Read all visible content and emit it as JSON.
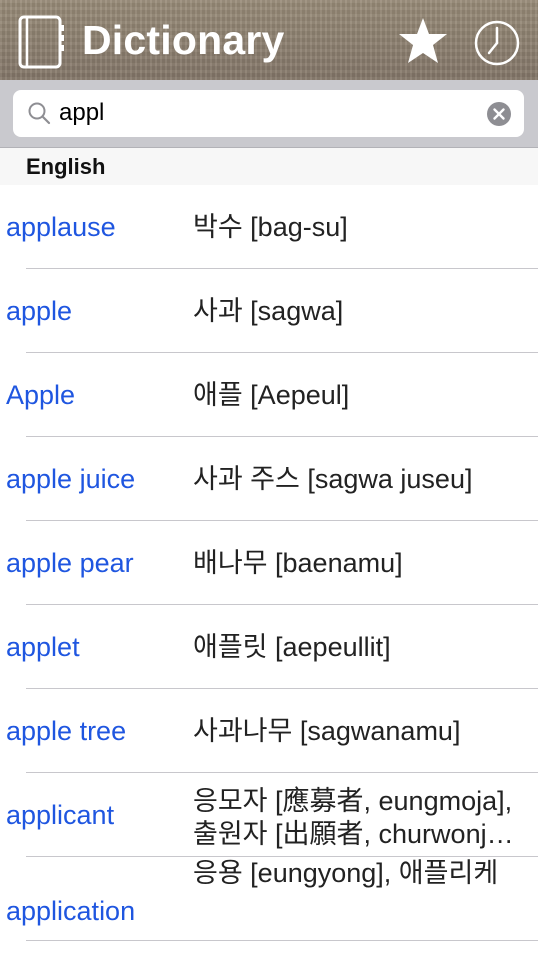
{
  "nav": {
    "title": "Dictionary"
  },
  "search": {
    "value": "appl"
  },
  "section": {
    "header": "English"
  },
  "entries": [
    {
      "word": "applause",
      "translation": "박수 [bag-su]"
    },
    {
      "word": "apple",
      "translation": "사과 [sagwa]"
    },
    {
      "word": "Apple",
      "translation": "애플 [Aepeul]"
    },
    {
      "word": "apple juice",
      "translation": "사과 주스 [sagwa juseu]"
    },
    {
      "word": "apple pear",
      "translation": "배나무 [baenamu]"
    },
    {
      "word": "applet",
      "translation": "애플릿 [aepeullit]"
    },
    {
      "word": "apple tree",
      "translation": "사과나무 [sagwanamu]"
    },
    {
      "word": "applicant",
      "translation_lines": [
        "응모자 [應募者, eungmoja],",
        "출원자 [出願者, churwonj…"
      ]
    },
    {
      "word": "application",
      "translation_lines": [
        "응용 [eungyong], 애플리케",
        ""
      ]
    }
  ],
  "colors": {
    "link": "#1f56e0",
    "navbar": "#8c7f6d",
    "searchbar": "#c9c9ce"
  },
  "icons": {
    "logo": "book-icon",
    "favorites": "star-icon",
    "history": "clock-icon",
    "search": "search-icon",
    "clear": "clear-icon"
  }
}
